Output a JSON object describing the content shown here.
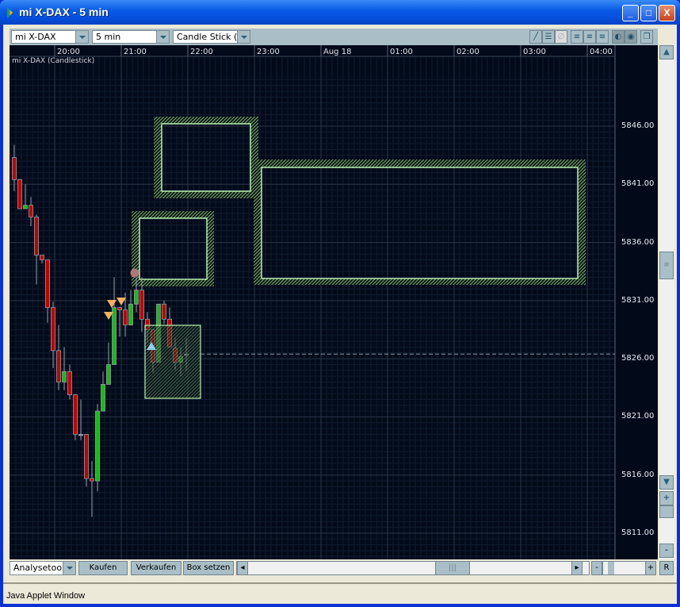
{
  "window": {
    "title": "mi X-DAX - 5 min",
    "minimize": "_",
    "maximize": "□",
    "close": "X"
  },
  "toolbar": {
    "instrument": "mi X-DAX",
    "interval": "5 min",
    "chart_type": "Candle Stick (Ke"
  },
  "chart": {
    "label": "mi X-DAX (Candlestick)",
    "time_labels": [
      "20:00",
      "21:00",
      "22:00",
      "23:00",
      "Aug 18",
      "01:00",
      "02:00",
      "03:00",
      "04:00"
    ],
    "price_labels": [
      "5846.00",
      "5841.00",
      "5836.00",
      "5831.00",
      "5826.00",
      "5821.00",
      "5816.00",
      "5811.00"
    ],
    "last_price": 5826.4,
    "up_color": "#10c010",
    "down_color": "#c00000",
    "chart_data": {
      "type": "candlestick",
      "ylim": [
        5808,
        5850
      ],
      "interval_minutes": 5,
      "first_candle_time": "19:25",
      "candles": [
        [
          5843.3,
          5844.4,
          5840.4,
          5841.4
        ],
        [
          5841.4,
          5841.4,
          5838.9,
          5838.9
        ],
        [
          5838.9,
          5841.0,
          5838.9,
          5839.2
        ],
        [
          5839.2,
          5839.9,
          5837.4,
          5838.2
        ],
        [
          5838.2,
          5838.4,
          5832.4,
          5834.9
        ],
        [
          5834.9,
          5834.9,
          5834.2,
          5834.5
        ],
        [
          5834.5,
          5834.5,
          5829.1,
          5830.4
        ],
        [
          5830.4,
          5830.9,
          5825.2,
          5826.7
        ],
        [
          5826.7,
          5828.9,
          5823.3,
          5824.0
        ],
        [
          5824.0,
          5827.0,
          5823.3,
          5824.9
        ],
        [
          5824.9,
          5825.5,
          5822.5,
          5822.9
        ],
        [
          5822.9,
          5822.9,
          5819.0,
          5819.5
        ],
        [
          5819.5,
          5822.5,
          5819.0,
          5819.5
        ],
        [
          5819.5,
          5819.5,
          5815.0,
          5815.7
        ],
        [
          5815.7,
          5817.2,
          5812.4,
          5815.5
        ],
        [
          5815.5,
          5822.1,
          5814.6,
          5821.5
        ],
        [
          5821.5,
          5824.9,
          5821.5,
          5823.8
        ],
        [
          5823.8,
          5827.4,
          5823.8,
          5825.5
        ],
        [
          5825.5,
          5833.0,
          5825.5,
          5830.4
        ],
        [
          5830.4,
          5830.4,
          5827.9,
          5830.2
        ],
        [
          5830.2,
          5831.7,
          5827.9,
          5828.9
        ],
        [
          5828.9,
          5831.9,
          5828.9,
          5830.7
        ],
        [
          5830.7,
          5833.0,
          5830.0,
          5831.9
        ],
        [
          5831.9,
          5833.0,
          5828.3,
          5829.4
        ],
        [
          5829.4,
          5830.0,
          5827.4,
          5828.5
        ],
        [
          5828.5,
          5828.5,
          5824.8,
          5825.7
        ],
        [
          5825.7,
          5830.7,
          5825.7,
          5830.7
        ],
        [
          5830.7,
          5831.0,
          5829.0,
          5829.4
        ],
        [
          5829.4,
          5830.4,
          5827.0,
          5827.0
        ],
        [
          5826.9,
          5827.8,
          5825.0,
          5825.7
        ],
        [
          5825.7,
          5827.0,
          5824.5,
          5826.2
        ],
        [
          5826.4,
          5827.8,
          5825.0,
          5826.4
        ]
      ]
    }
  },
  "bottom": {
    "tool": "Analysetool",
    "buy": "Kaufen",
    "sell": "Verkaufen",
    "box": "Box setzen",
    "reset": "R",
    "zoom_in": "+",
    "zoom_out": "-"
  },
  "status": "Java Applet Window"
}
